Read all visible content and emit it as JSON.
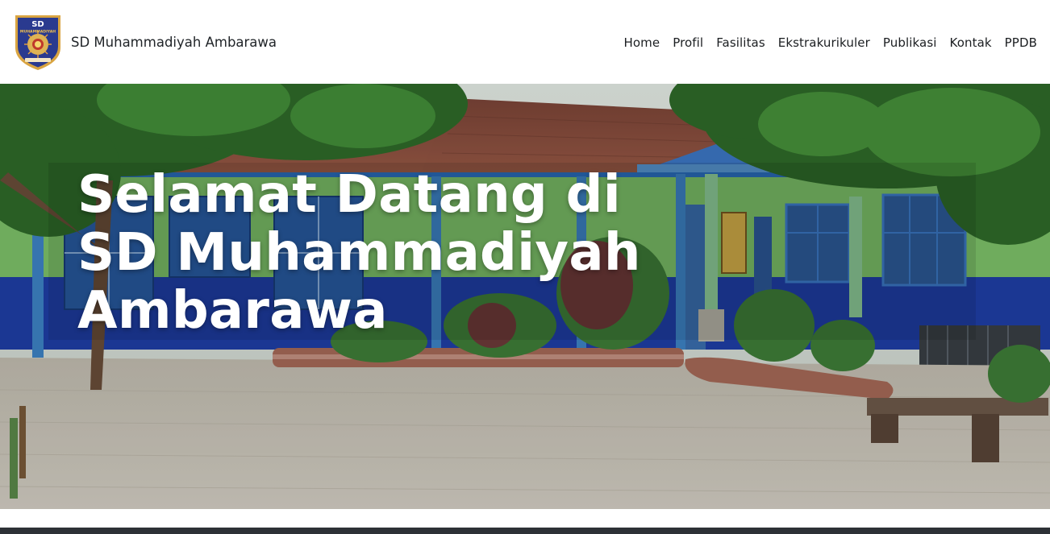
{
  "navbar": {
    "brand_name": "SD Muhammadiyah Ambarawa",
    "logo": {
      "icon": "school-emblem-icon",
      "emblem_text": "SD",
      "emblem_subtext": "MUHAMMADIYAH",
      "colors": {
        "shield": "#2a3a8f",
        "border": "#d9a441",
        "sun": "#e8a23a"
      }
    },
    "links": [
      {
        "label": "Home"
      },
      {
        "label": "Profil"
      },
      {
        "label": "Fasilitas"
      },
      {
        "label": "Ekstrakurikuler"
      },
      {
        "label": "Publikasi"
      },
      {
        "label": "Kontak"
      },
      {
        "label": "PPDB"
      }
    ]
  },
  "hero": {
    "title": "Selamat Datang di SD Muhammadiyah Ambarawa",
    "background": "school-courtyard-photo",
    "colors": {
      "wall_green": "#7fc46a",
      "wall_blue": "#1f3fa8",
      "roof": "#8a4a3a",
      "foliage": "#2f6b2a",
      "ground": "#c9c3b6"
    }
  }
}
